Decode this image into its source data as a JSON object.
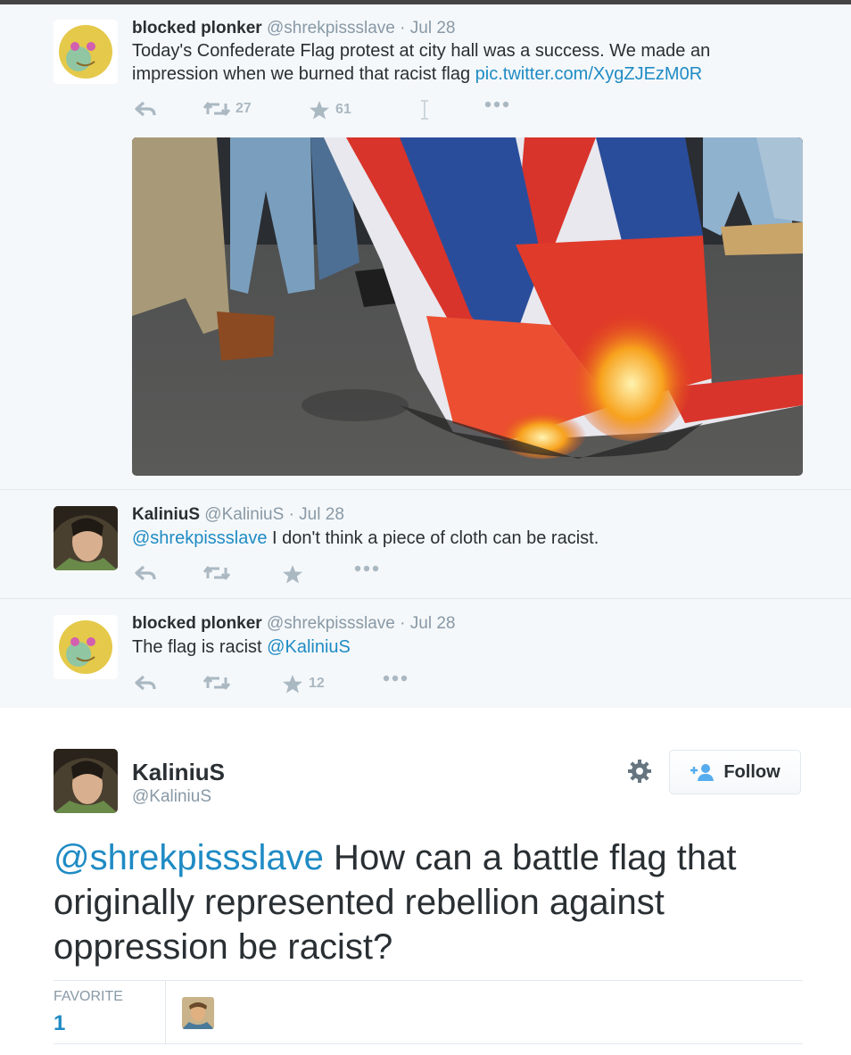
{
  "tweets": [
    {
      "fullname": "blocked plonker",
      "handle": "@shrekpissslave",
      "date": "· Jul 28",
      "text": "Today's Confederate Flag protest at city hall was a success. We made an impression when we burned that racist flag ",
      "link": "pic.twitter.com/XygZJEzM0R",
      "retweets": "27",
      "favorites": "61"
    },
    {
      "fullname": "KaliniuS",
      "handle": "@KaliniuS",
      "date": "· Jul 28",
      "mention": "@shrekpissslave",
      "text": " I don't think a piece of cloth can be racist."
    },
    {
      "fullname": "blocked plonker",
      "handle": "@shrekpissslave",
      "date": "· Jul 28",
      "text": "The flag is racist ",
      "mention": "@KaliniuS",
      "favorites": "12"
    }
  ],
  "main": {
    "fullname": "KaliniuS",
    "handle": "@KaliniuS",
    "follow_label": "Follow",
    "mention": "@shrekpissslave",
    "text": " How can a battle flag that originally represented rebellion against oppression be racist?",
    "favorite_label": "FAVORITE",
    "favorite_count": "1"
  },
  "colors": {
    "link": "#1f8bc4",
    "muted": "#8899a6",
    "thread_bg": "#f5f8fa"
  },
  "icons": [
    "reply-icon",
    "retweet-icon",
    "favorite-icon",
    "more-icon",
    "gear-icon",
    "follow-icon"
  ]
}
